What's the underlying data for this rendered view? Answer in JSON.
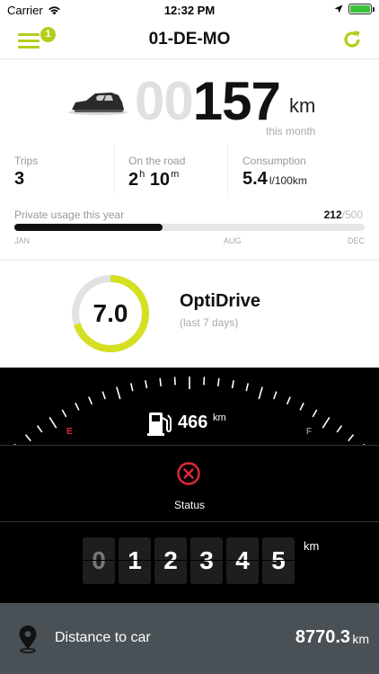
{
  "status_bar": {
    "carrier": "Carrier",
    "time": "12:32 PM"
  },
  "nav": {
    "title": "01-DE-MO",
    "badge_count": "1",
    "menu_icon": "hamburger-menu-icon",
    "refresh_icon": "refresh-icon"
  },
  "distance": {
    "leading_zeros": "00",
    "value": "157",
    "unit": "km",
    "period": "this month"
  },
  "stats": {
    "trips": {
      "label": "Trips",
      "value": "3"
    },
    "on_the_road": {
      "label": "On the road",
      "hours": "2",
      "hours_unit": "h",
      "minutes": "10",
      "minutes_unit": "m"
    },
    "consumption": {
      "label": "Consumption",
      "value": "5.4",
      "unit": "l/100km"
    }
  },
  "private_usage": {
    "label": "Private usage this year",
    "used": "212",
    "limit": "/500",
    "progress_fraction": 0.424,
    "months": [
      "JAN",
      "AUG",
      "DEC"
    ]
  },
  "optidrive": {
    "score": "7.0",
    "score_fraction": 0.7,
    "title": "OptiDrive",
    "subtitle": "(last 7 days)"
  },
  "fuel": {
    "range": "466",
    "unit": "km",
    "gauge_empty": "E",
    "gauge_full": "F"
  },
  "status": {
    "label": "Status",
    "icon": "error-x-icon"
  },
  "odometer": {
    "digits": [
      "0",
      "1",
      "2",
      "3",
      "4",
      "5"
    ],
    "unit": "km"
  },
  "distance_to_car": {
    "label": "Distance to car",
    "value": "8770.3",
    "unit": "km"
  },
  "colors": {
    "accent": "#b5cc1a",
    "status_red": "#e0283b",
    "bottom_bar": "#4a5156"
  }
}
